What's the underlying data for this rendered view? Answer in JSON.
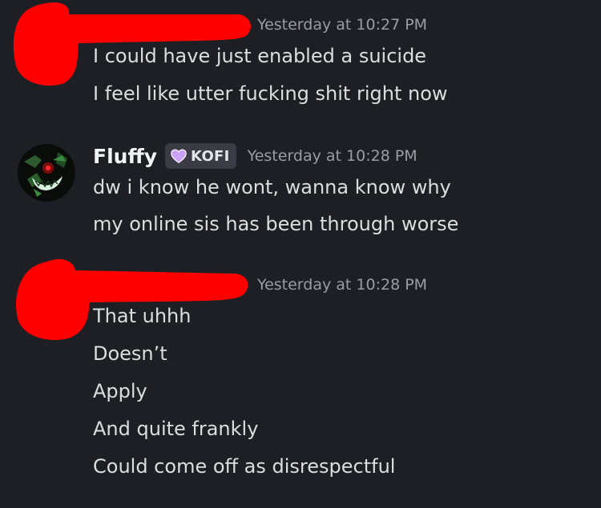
{
  "groups": [
    {
      "author": "",
      "badge": "",
      "timestamp": "Yesterday at 10:27 PM",
      "messages": [
        "I could have just enabled a suicide",
        "I feel like utter fucking shit right now"
      ]
    },
    {
      "author": "Fluffy",
      "badge": "KOFI",
      "timestamp": "Yesterday at 10:28 PM",
      "messages": [
        "dw i know he wont, wanna know why",
        "my online sis has been through worse"
      ]
    },
    {
      "author": "",
      "badge": "",
      "timestamp": "Yesterday at 10:28 PM",
      "messages": [
        "That uhhh",
        "Doesn’t",
        "Apply",
        "And quite frankly",
        "Could come off as disrespectful"
      ]
    }
  ],
  "colors": {
    "background": "#1e1f25",
    "redaction": "#ff0000",
    "timestamp": "#9a9ca5",
    "message_text": "#dbdee1",
    "username": "#f2f3f5",
    "badge_heart": "#c9a2f5"
  },
  "icons": {
    "badge": "heart-icon"
  }
}
